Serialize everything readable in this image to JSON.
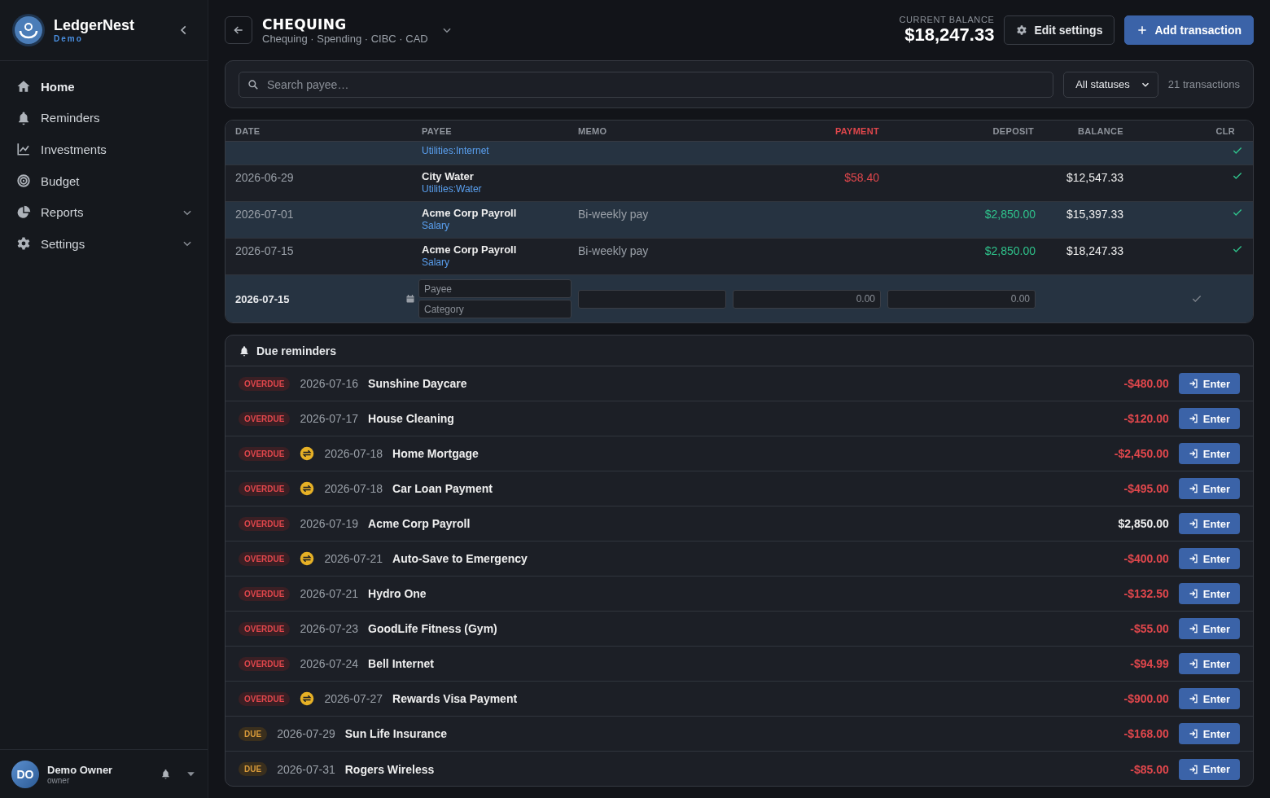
{
  "brand": {
    "name": "LedgerNest",
    "edition": "Demo"
  },
  "nav": [
    {
      "label": "Home",
      "expandable": false
    },
    {
      "label": "Reminders",
      "expandable": false
    },
    {
      "label": "Investments",
      "expandable": false
    },
    {
      "label": "Budget",
      "expandable": false
    },
    {
      "label": "Reports",
      "expandable": true
    },
    {
      "label": "Settings",
      "expandable": true
    }
  ],
  "user": {
    "initials": "DO",
    "name": "Demo Owner",
    "role": "owner"
  },
  "account": {
    "title": "CHEQUING",
    "subtitle": "Chequing · Spending · CIBC · CAD",
    "balance_label": "CURRENT BALANCE",
    "balance": "$18,247.33"
  },
  "actions": [
    {
      "label": "Edit settings",
      "kind": "secondary"
    },
    {
      "label": "Add transaction",
      "kind": "primary"
    }
  ],
  "filter": {
    "search_placeholder": "Search payee…",
    "status": "All statuses",
    "count": "21 transactions"
  },
  "table": {
    "columns": [
      {
        "label": "DATE",
        "kind": "text"
      },
      {
        "label": "PAYEE",
        "kind": "text"
      },
      {
        "label": "MEMO",
        "kind": "text"
      },
      {
        "label": "PAYMENT",
        "kind": "payment"
      },
      {
        "label": "DEPOSIT",
        "kind": "num"
      },
      {
        "label": "BALANCE",
        "kind": "num"
      },
      {
        "label": "CLR",
        "kind": "num"
      }
    ],
    "rows": [
      {
        "category": "Utilities:Internet",
        "cleared": true,
        "partial": true
      },
      {
        "date": "2026-06-29",
        "payee": "City Water",
        "category": "Utilities:Water",
        "payment": "$58.40",
        "balance": "$12,547.33",
        "cleared": true
      },
      {
        "date": "2026-07-01",
        "payee": "Acme Corp Payroll",
        "category": "Salary",
        "memo": "Bi-weekly pay",
        "deposit": "$2,850.00",
        "balance": "$15,397.33",
        "cleared": true
      },
      {
        "date": "2026-07-15",
        "payee": "Acme Corp Payroll",
        "category": "Salary",
        "memo": "Bi-weekly pay",
        "deposit": "$2,850.00",
        "balance": "$18,247.33",
        "cleared": true
      }
    ],
    "entry": {
      "date": "2026-07-15",
      "payee_placeholder": "Payee",
      "category_placeholder": "Category",
      "payment_placeholder": "0.00",
      "deposit_placeholder": "0.00",
      "cleared": false
    }
  },
  "reminders": {
    "title": "Due reminders",
    "items": [
      {
        "status": "OVERDUE",
        "kind": "overdue",
        "recurring": false,
        "date": "2026-07-16",
        "payee": "Sunshine Daycare",
        "amount": "-$480.00",
        "negative": true,
        "button": "Enter"
      },
      {
        "status": "OVERDUE",
        "kind": "overdue",
        "recurring": false,
        "date": "2026-07-17",
        "payee": "House Cleaning",
        "amount": "-$120.00",
        "negative": true,
        "button": "Enter"
      },
      {
        "status": "OVERDUE",
        "kind": "overdue",
        "recurring": true,
        "date": "2026-07-18",
        "payee": "Home Mortgage",
        "amount": "-$2,450.00",
        "negative": true,
        "button": "Enter"
      },
      {
        "status": "OVERDUE",
        "kind": "overdue",
        "recurring": true,
        "date": "2026-07-18",
        "payee": "Car Loan Payment",
        "amount": "-$495.00",
        "negative": true,
        "button": "Enter"
      },
      {
        "status": "OVERDUE",
        "kind": "overdue",
        "recurring": false,
        "date": "2026-07-19",
        "payee": "Acme Corp Payroll",
        "amount": "$2,850.00",
        "negative": false,
        "button": "Enter"
      },
      {
        "status": "OVERDUE",
        "kind": "overdue",
        "recurring": true,
        "date": "2026-07-21",
        "payee": "Auto-Save to Emergency",
        "amount": "-$400.00",
        "negative": true,
        "button": "Enter"
      },
      {
        "status": "OVERDUE",
        "kind": "overdue",
        "recurring": false,
        "date": "2026-07-21",
        "payee": "Hydro One",
        "amount": "-$132.50",
        "negative": true,
        "button": "Enter"
      },
      {
        "status": "OVERDUE",
        "kind": "overdue",
        "recurring": false,
        "date": "2026-07-23",
        "payee": "GoodLife Fitness (Gym)",
        "amount": "-$55.00",
        "negative": true,
        "button": "Enter"
      },
      {
        "status": "OVERDUE",
        "kind": "overdue",
        "recurring": false,
        "date": "2026-07-24",
        "payee": "Bell Internet",
        "amount": "-$94.99",
        "negative": true,
        "button": "Enter"
      },
      {
        "status": "OVERDUE",
        "kind": "overdue",
        "recurring": true,
        "date": "2026-07-27",
        "payee": "Rewards Visa Payment",
        "amount": "-$900.00",
        "negative": true,
        "button": "Enter"
      },
      {
        "status": "DUE",
        "kind": "due",
        "recurring": false,
        "date": "2026-07-29",
        "payee": "Sun Life Insurance",
        "amount": "-$168.00",
        "negative": true,
        "button": "Enter"
      },
      {
        "status": "DUE",
        "kind": "due",
        "recurring": false,
        "date": "2026-07-31",
        "payee": "Rogers Wireless",
        "amount": "-$85.00",
        "negative": true,
        "button": "Enter"
      }
    ]
  }
}
